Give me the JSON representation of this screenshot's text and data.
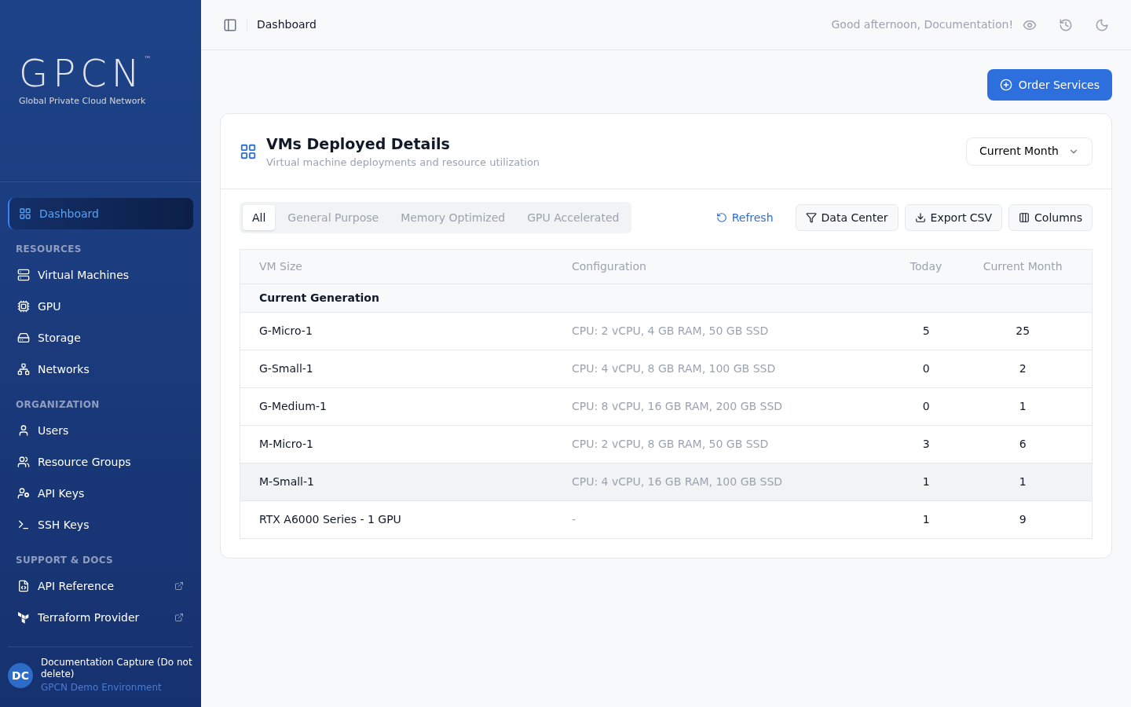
{
  "sidebar": {
    "logo": {
      "mark": "GPCN",
      "tm": "™",
      "tagline": "Global Private Cloud Network"
    },
    "items": [
      {
        "label": "Dashboard",
        "kind": "grid",
        "selected": true
      }
    ],
    "sections": [
      {
        "title": "RESOURCES",
        "items": [
          {
            "label": "Virtual Machines",
            "kind": "server",
            "selected": false
          },
          {
            "label": "GPU",
            "kind": "cpu",
            "selected": false
          },
          {
            "label": "Storage",
            "kind": "drive",
            "selected": false
          },
          {
            "label": "Networks",
            "kind": "network",
            "selected": false
          }
        ]
      },
      {
        "title": "ORGANIZATION",
        "items": [
          {
            "label": "Users",
            "kind": "user",
            "selected": false
          },
          {
            "label": "Resource Groups",
            "kind": "users",
            "selected": false
          },
          {
            "label": "API Keys",
            "kind": "userkey",
            "selected": false
          },
          {
            "label": "SSH Keys",
            "kind": "terminal",
            "selected": false
          }
        ]
      },
      {
        "title": "SUPPORT & DOCS",
        "items": [
          {
            "label": "API Reference",
            "kind": "filecode",
            "selected": false,
            "external": true
          },
          {
            "label": "Terraform Provider",
            "kind": "terraform",
            "selected": false,
            "external": true
          }
        ]
      }
    ],
    "account": {
      "initials": "DC",
      "name": "Documentation Capture (Do not delete)",
      "environment": "GPCN Demo Environment"
    }
  },
  "header": {
    "breadcrumb": "Dashboard",
    "greeting": "Good afternoon, Documentation!"
  },
  "order_button": "Order Services",
  "card": {
    "title": "VMs Deployed Details",
    "subtitle": "Virtual machine deployments and resource utilization",
    "period": "Current Month",
    "tabs": [
      {
        "label": "All",
        "selected": true
      },
      {
        "label": "General Purpose",
        "selected": false
      },
      {
        "label": "Memory Optimized",
        "selected": false
      },
      {
        "label": "GPU Accelerated",
        "selected": false
      }
    ],
    "actions": [
      {
        "label": "Refresh",
        "kind": "link"
      },
      {
        "label": "Data Center",
        "kind": "outline"
      },
      {
        "label": "Export CSV",
        "kind": "outline"
      },
      {
        "label": "Columns",
        "kind": "outline"
      }
    ],
    "table": {
      "columns": [
        "VM Size",
        "Configuration",
        "Today",
        "Current Month"
      ],
      "rows": [
        {
          "kind": "group",
          "label": "Current Generation"
        },
        {
          "kind": "row",
          "cells": [
            "G-Micro-1",
            "CPU: 2 vCPU, 4 GB RAM, 50 GB SSD",
            "5",
            "25"
          ],
          "selected": false
        },
        {
          "kind": "row",
          "cells": [
            "G-Small-1",
            "CPU: 4 vCPU, 8 GB RAM, 100 GB SSD",
            "0",
            "2"
          ],
          "selected": false
        },
        {
          "kind": "row",
          "cells": [
            "G-Medium-1",
            "CPU: 8 vCPU, 16 GB RAM, 200 GB SSD",
            "0",
            "1"
          ],
          "selected": false
        },
        {
          "kind": "row",
          "cells": [
            "M-Micro-1",
            "CPU: 2 vCPU, 8 GB RAM, 50 GB SSD",
            "3",
            "6"
          ],
          "selected": false
        },
        {
          "kind": "row",
          "cells": [
            "M-Small-1",
            "CPU: 4 vCPU, 16 GB RAM, 100 GB SSD",
            "1",
            "1"
          ],
          "selected": true
        },
        {
          "kind": "row",
          "cells": [
            "RTX A6000 Series - 1 GPU",
            "-",
            "1",
            "9"
          ],
          "selected": false
        }
      ]
    }
  }
}
